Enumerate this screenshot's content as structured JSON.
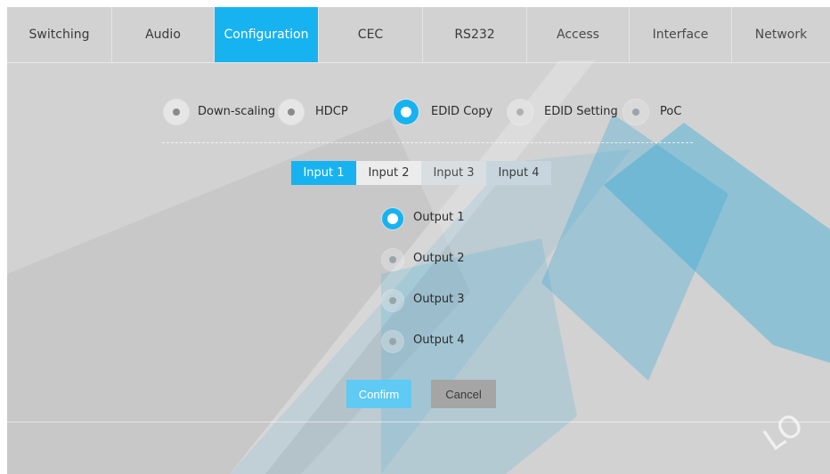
{
  "topnav": {
    "tabs": [
      {
        "label": "Switching"
      },
      {
        "label": "Audio"
      },
      {
        "label": "Configuration"
      },
      {
        "label": "CEC"
      },
      {
        "label": "RS232"
      },
      {
        "label": "Access"
      },
      {
        "label": "Interface"
      },
      {
        "label": "Network"
      }
    ],
    "active": "Configuration"
  },
  "config_menu": {
    "items": [
      {
        "label": "Down-scaling",
        "selected": false
      },
      {
        "label": "HDCP",
        "selected": false
      },
      {
        "label": "EDID Copy",
        "selected": true
      },
      {
        "label": "EDID Setting",
        "selected": false
      },
      {
        "label": "PoC",
        "selected": false
      }
    ]
  },
  "input_tabs": {
    "items": [
      {
        "label": "Input 1"
      },
      {
        "label": "Input 2"
      },
      {
        "label": "Input 3"
      },
      {
        "label": "Input 4"
      }
    ],
    "active": "Input 1"
  },
  "outputs": {
    "items": [
      {
        "label": "Output 1",
        "selected": true
      },
      {
        "label": "Output 2",
        "selected": false
      },
      {
        "label": "Output 3",
        "selected": false
      },
      {
        "label": "Output 4",
        "selected": false
      }
    ]
  },
  "actions": {
    "confirm_label": "Confirm",
    "cancel_label": "Cancel"
  },
  "colors": {
    "accent": "#17b3f0",
    "background": "#d2d2d2",
    "watermark": "#2aa7d6"
  }
}
